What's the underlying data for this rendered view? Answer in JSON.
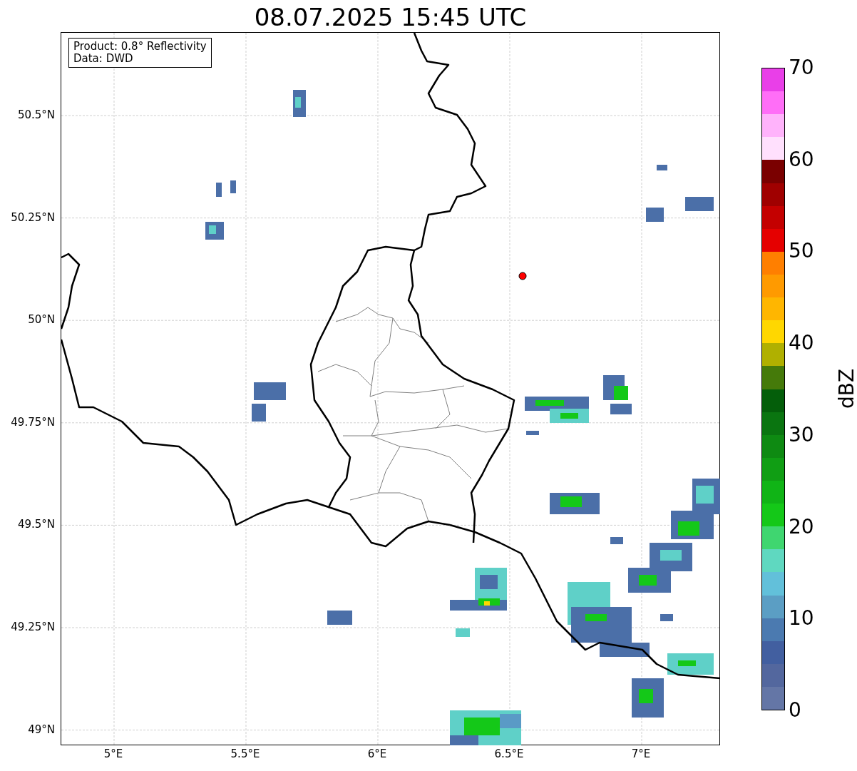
{
  "title": "08.07.2025 15:45 UTC",
  "legend": {
    "lines": [
      "Product: 0.8° Reflectivity",
      "Data: DWD"
    ]
  },
  "x_ticks": [
    "5°E",
    "5.5°E",
    "6°E",
    "6.5°E",
    "7°E"
  ],
  "y_ticks": [
    "50.5°N",
    "50.25°N",
    "50°N",
    "49.75°N",
    "49.5°N",
    "49.25°N",
    "49°N"
  ],
  "colorbar": {
    "label": "dBZ",
    "ticks": [
      "70",
      "60",
      "50",
      "40",
      "30",
      "20",
      "10",
      "0"
    ],
    "segments": [
      {
        "color": "#e93fe8"
      },
      {
        "color": "#ff6ef7"
      },
      {
        "color": "#ffb3fb"
      },
      {
        "color": "#ffe0fd"
      },
      {
        "color": "#7a0000"
      },
      {
        "color": "#a00000"
      },
      {
        "color": "#c40000"
      },
      {
        "color": "#e50000"
      },
      {
        "color": "#ff7f00"
      },
      {
        "color": "#ff9a00"
      },
      {
        "color": "#ffb600"
      },
      {
        "color": "#ffd700"
      },
      {
        "color": "#b0b000"
      },
      {
        "color": "#457a0a"
      },
      {
        "color": "#045e0a"
      },
      {
        "color": "#0a7510"
      },
      {
        "color": "#0e8a12"
      },
      {
        "color": "#109e14"
      },
      {
        "color": "#10b416"
      },
      {
        "color": "#14c818"
      },
      {
        "color": "#3fd670"
      },
      {
        "color": "#5fd8c0"
      },
      {
        "color": "#62c0da"
      },
      {
        "color": "#5b9ec4"
      },
      {
        "color": "#4b7ab0"
      },
      {
        "color": "#425fa0"
      },
      {
        "color": "#53679e"
      },
      {
        "color": "#6476a6"
      }
    ]
  }
}
